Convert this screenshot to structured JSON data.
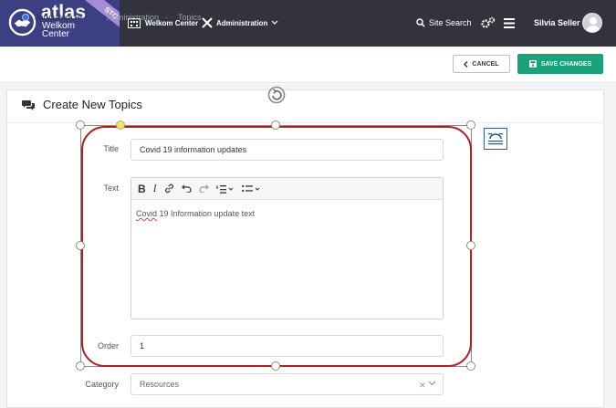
{
  "brand": {
    "name": "atlas",
    "sub1": "Welkom",
    "sub2": "Center",
    "env_badge": "STG",
    "colors": {
      "logo_bg": "#3c3f82",
      "topbar_bg": "#33333d",
      "accent": "#1aa37a",
      "shape_outline": "#b01e1e"
    }
  },
  "topnav": {
    "welkom": "Welkom Center",
    "admin": "Administration",
    "search": "Site Search",
    "user": "Silvia Seller"
  },
  "subheader": {
    "location": "Jerusalem",
    "crumb1": "Administration",
    "crumb_sep": "·",
    "crumb2": "Topics",
    "cancel": "CANCEL",
    "save": "SAVE CHANGES"
  },
  "form": {
    "title": "Create New Topics",
    "fields": {
      "title_label": "Title",
      "title_value": "Covid 19 information updates",
      "text_label": "Text",
      "text_value_word1": "Covid",
      "text_value_rest": " 19 Information update text",
      "order_label": "Order",
      "order_value": "1",
      "category_label": "Category",
      "category_value": "Resources"
    },
    "toolbar_icons": [
      "bold-icon",
      "italic-icon",
      "link-icon",
      "undo-icon",
      "redo-icon",
      "ordered-list-icon",
      "bullet-list-icon"
    ]
  }
}
